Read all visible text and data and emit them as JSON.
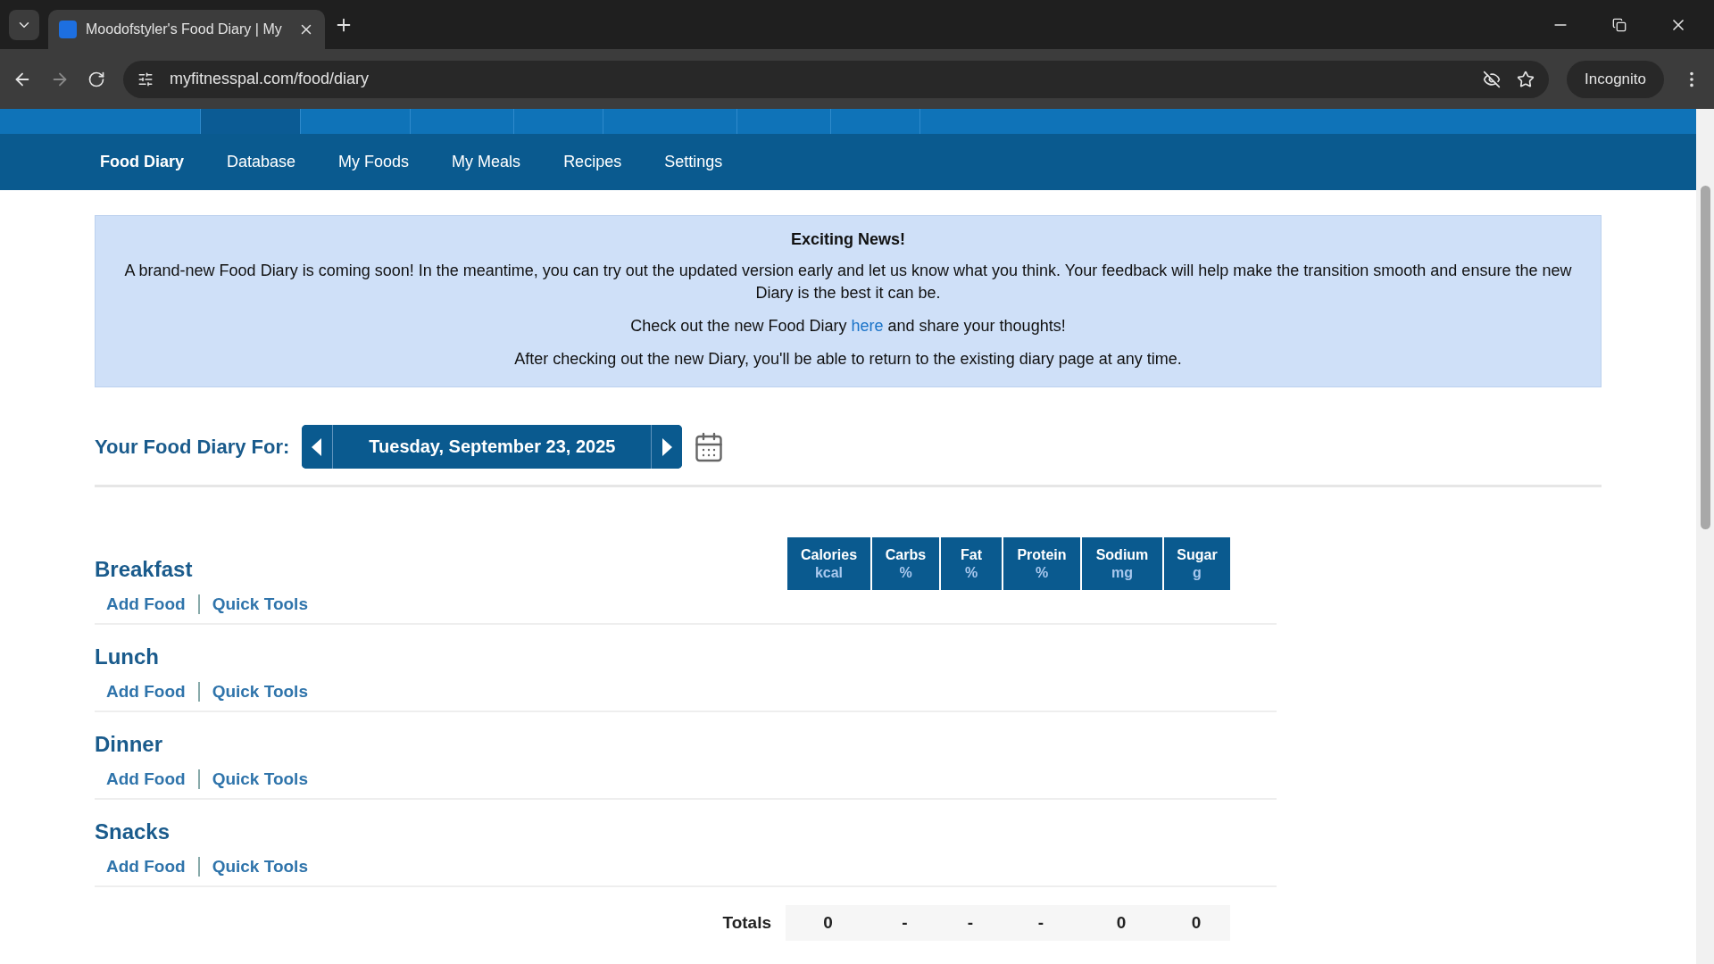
{
  "browser": {
    "tab_title": "Moodofstyler's Food Diary | My",
    "url": "myfitnesspal.com/food/diary",
    "profile": "Incognito"
  },
  "top_nav": [
    {
      "selected": false
    },
    {
      "selected": true
    },
    {
      "selected": false
    },
    {
      "selected": false
    },
    {
      "selected": false
    },
    {
      "selected": false
    },
    {
      "selected": false
    },
    {
      "selected": false
    }
  ],
  "sub_nav": [
    {
      "label": "Food Diary",
      "selected": true
    },
    {
      "label": "Database",
      "selected": false
    },
    {
      "label": "My Foods",
      "selected": false
    },
    {
      "label": "My Meals",
      "selected": false
    },
    {
      "label": "Recipes",
      "selected": false
    },
    {
      "label": "Settings",
      "selected": false
    }
  ],
  "notice": {
    "title": "Exciting News!",
    "body": "A brand-new Food Diary is coming soon! In the meantime, you can try out the updated version early and let us know what you think. Your feedback will help make the transition smooth and ensure the new Diary is the best it can be.",
    "link_line": {
      "before": "Check out the new Food Diary",
      "link": "here",
      "after": "and share your thoughts!"
    },
    "footer": "After checking out the new Diary, you'll be able to return to the existing diary page at any time."
  },
  "date_nav": {
    "label": "Your Food Diary For:",
    "date": "Tuesday, September 23, 2025"
  },
  "columns": [
    {
      "name": "Calories",
      "unit": "kcal"
    },
    {
      "name": "Carbs",
      "unit": "%"
    },
    {
      "name": "Fat",
      "unit": "%"
    },
    {
      "name": "Protein",
      "unit": "%"
    },
    {
      "name": "Sodium",
      "unit": "mg"
    },
    {
      "name": "Sugar",
      "unit": "g"
    }
  ],
  "meals": [
    {
      "name": "Breakfast",
      "actions": [
        "Add Food",
        "Quick Tools"
      ]
    },
    {
      "name": "Lunch",
      "actions": [
        "Add Food",
        "Quick Tools"
      ]
    },
    {
      "name": "Dinner",
      "actions": [
        "Add Food",
        "Quick Tools"
      ]
    },
    {
      "name": "Snacks",
      "actions": [
        "Add Food",
        "Quick Tools"
      ]
    }
  ],
  "totals": {
    "label": "Totals",
    "values": [
      "0",
      "-",
      "-",
      "-",
      "0",
      "0"
    ]
  }
}
